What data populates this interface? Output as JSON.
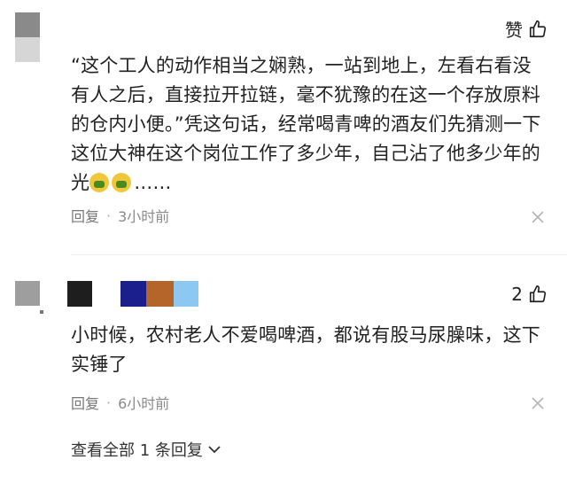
{
  "comments": [
    {
      "like_label": "赞",
      "text": "“这个工人的动作相当之娴熟，一站到地上，左看右看没有人之后，直接拉开拉链，毫不犹豫的在这一个存放原料的仓内小便。”凭这句话，经常喝青啤的酒友们先猜测一下这位大神在这个岗位工作了多少年，自己沾了他多少年的光",
      "text_suffix": "……",
      "emoji": "nauseated-face",
      "reply_label": "回复",
      "time": "3小时前"
    },
    {
      "like_count": "2",
      "text": "小时候，农村老人不爱喝啤酒，都说有股马尿臊味，这下实锤了",
      "reply_label": "回复",
      "time": "6小时前"
    }
  ],
  "expand_replies": "查看全部 1 条回复",
  "colors": {
    "avatar1_top": "#8a8a8a",
    "avatar1_bottom": "#d6d6d6",
    "avatar2_top": "#9e9e9e",
    "name_block_1": "#1e1e1e",
    "name_block_2": "#1a1f8c",
    "name_block_3": "#b5652a",
    "name_block_4": "#8cc8f2"
  }
}
